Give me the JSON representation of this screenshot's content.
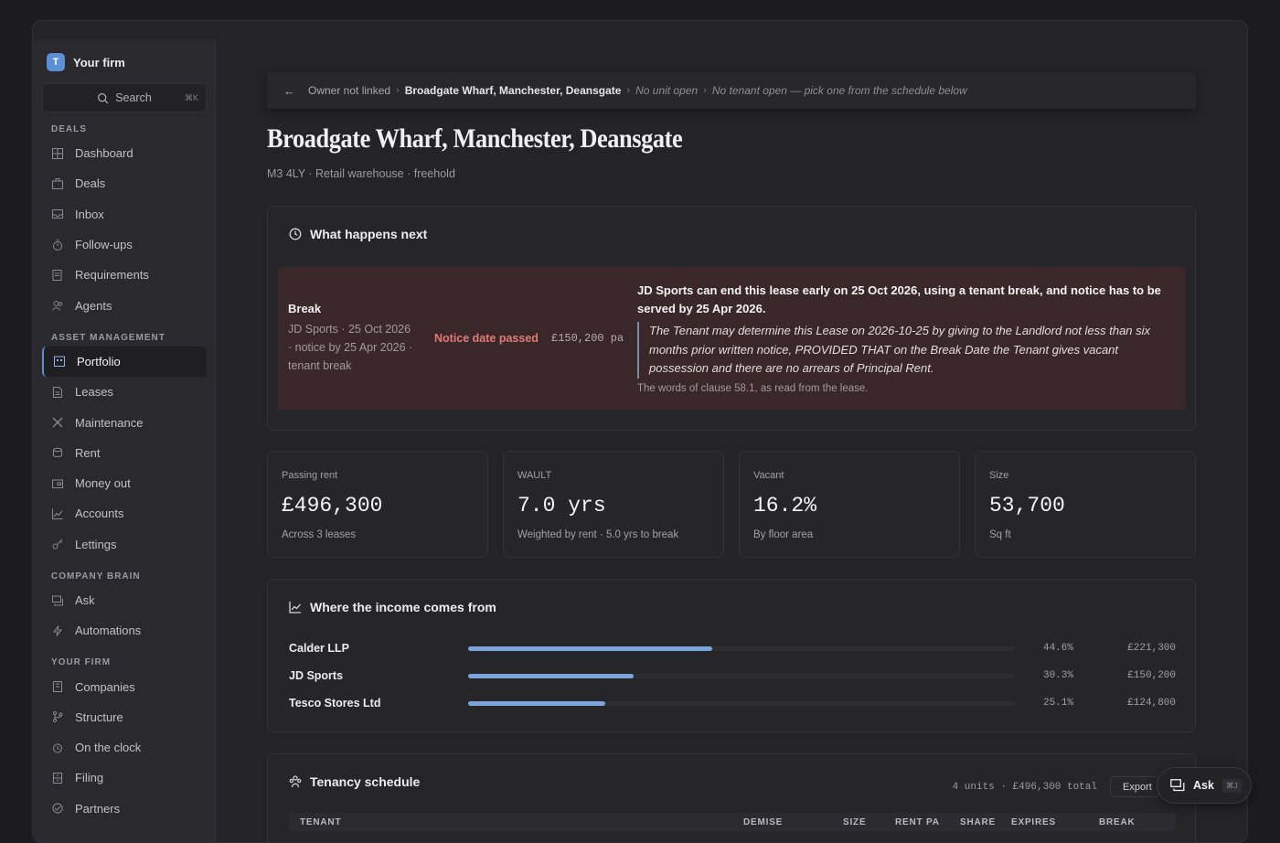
{
  "firm": {
    "logo_letter": "T",
    "name": "Your firm"
  },
  "search": {
    "label": "Search",
    "shortcut": "⌘K"
  },
  "nav": {
    "deals_section": "DEALS",
    "deals": [
      "Dashboard",
      "Deals",
      "Inbox",
      "Follow-ups",
      "Requirements",
      "Agents"
    ],
    "asset_section": "ASSET MANAGEMENT",
    "asset": [
      "Portfolio",
      "Leases",
      "Maintenance",
      "Rent",
      "Money out",
      "Accounts",
      "Lettings"
    ],
    "brain_section": "COMPANY BRAIN",
    "brain": [
      "Ask",
      "Automations"
    ],
    "firm_section": "YOUR FIRM",
    "firm": [
      "Companies",
      "Structure",
      "On the clock",
      "Filing",
      "Partners"
    ]
  },
  "breadcrumb": {
    "owner": "Owner not linked",
    "property": "Broadgate Wharf, Manchester, Deansgate",
    "unit": "No unit open",
    "tenant": "No tenant open — pick one from the schedule below"
  },
  "page": {
    "title": "Broadgate Wharf, Manchester, Deansgate",
    "subtitle": "M3 4LY · Retail warehouse · freehold"
  },
  "next": {
    "heading": "What happens next",
    "event_type": "Break",
    "event_meta": "JD Sports · 25 Oct 2026 · notice by 25 Apr 2026 · tenant break",
    "status": "Notice date passed",
    "amount": "£150,200 pa",
    "lead": "JD Sports can end this lease early on 25 Oct 2026, using a tenant break, and notice has to be served by 25 Apr 2026.",
    "quote": "The Tenant may determine this Lease on 2026-10-25 by giving to the Landlord not less than six months prior written notice, PROVIDED THAT on the Break Date the Tenant gives vacant possession and there are no arrears of Principal Rent.",
    "source": "The words of clause 58.1, as read from the lease.",
    "status_color": "#e07b73"
  },
  "stats": [
    {
      "label": "Passing rent",
      "value": "£496,300",
      "sub": "Across 3 leases"
    },
    {
      "label": "WAULT",
      "value": "7.0 yrs",
      "sub": "Weighted by rent · 5.0 yrs to break"
    },
    {
      "label": "Vacant",
      "value": "16.2%",
      "sub": "By floor area"
    },
    {
      "label": "Size",
      "value": "53,700",
      "sub": "Sq ft"
    }
  ],
  "income": {
    "heading": "Where the income comes from",
    "rows": [
      {
        "name": "Calder LLP",
        "share": 0.446,
        "pct": "44.6%",
        "amount": "£221,300"
      },
      {
        "name": "JD Sports",
        "share": 0.303,
        "pct": "30.3%",
        "amount": "£150,200"
      },
      {
        "name": "Tesco Stores Ltd",
        "share": 0.251,
        "pct": "25.1%",
        "amount": "£124,800"
      }
    ],
    "bar_color": "#7ba3dc"
  },
  "tenancy": {
    "heading": "Tenancy schedule",
    "summary": "4 units · £496,300 total",
    "export_label": "Export",
    "columns": [
      "TENANT",
      "DEMISE",
      "SIZE",
      "RENT PA",
      "SHARE",
      "EXPIRES",
      "BREAK"
    ]
  },
  "ask": {
    "label": "Ask",
    "shortcut": "⌘J"
  },
  "colors": {
    "accent": "#5b8fd6",
    "alert_bg": "#3a2729"
  }
}
